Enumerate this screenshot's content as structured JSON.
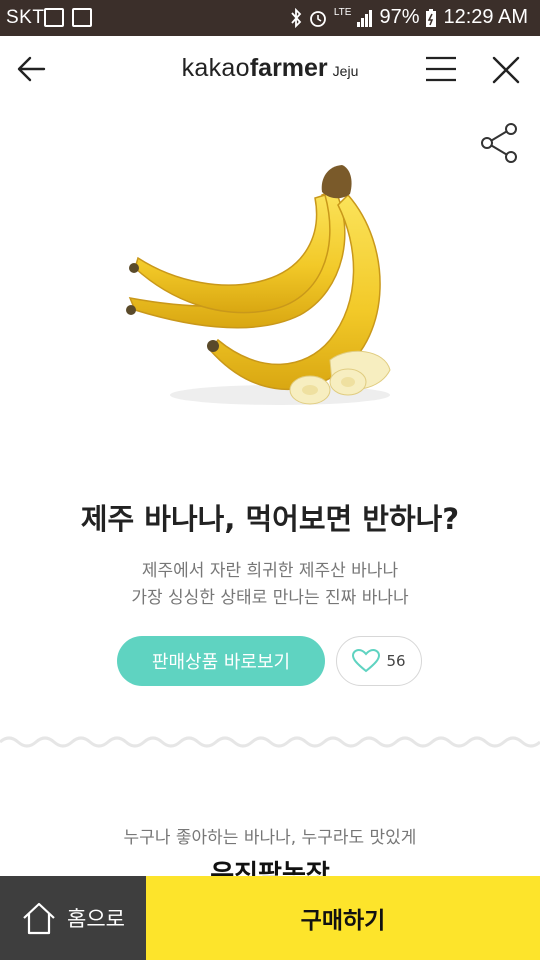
{
  "status_bar": {
    "carrier": "SKT",
    "lte": "LTE",
    "battery": "97%",
    "time": "12:29 AM"
  },
  "header": {
    "logo_part1": "kakao",
    "logo_part2": "farmer",
    "logo_region": "Jeju"
  },
  "icons": {
    "back": "arrow-left-icon",
    "menu": "hamburger-menu-icon",
    "close": "close-icon",
    "share": "share-icon",
    "heart": "heart-icon",
    "home": "home-icon"
  },
  "product": {
    "title": "제주 바나나, 먹어보면 반하나?",
    "subtitle_line1": "제주에서 자란 희귀한 제주산 바나나",
    "subtitle_line2": "가장 싱싱한 상태로 만나는 진짜 바나나",
    "view_button": "판매상품 바로보기",
    "like_count": "56"
  },
  "section": {
    "subtitle": "누구나 좋아하는 바나나, 누구라도 맛있게",
    "title": "은진팜농장"
  },
  "bottom_bar": {
    "home_label": "홈으로",
    "buy_label": "구매하기"
  },
  "colors": {
    "status_bar": "#3b2f2a",
    "accent_teal": "#5fd3c1",
    "buy_yellow": "#fde42b",
    "home_dark": "#3e3e3e"
  }
}
